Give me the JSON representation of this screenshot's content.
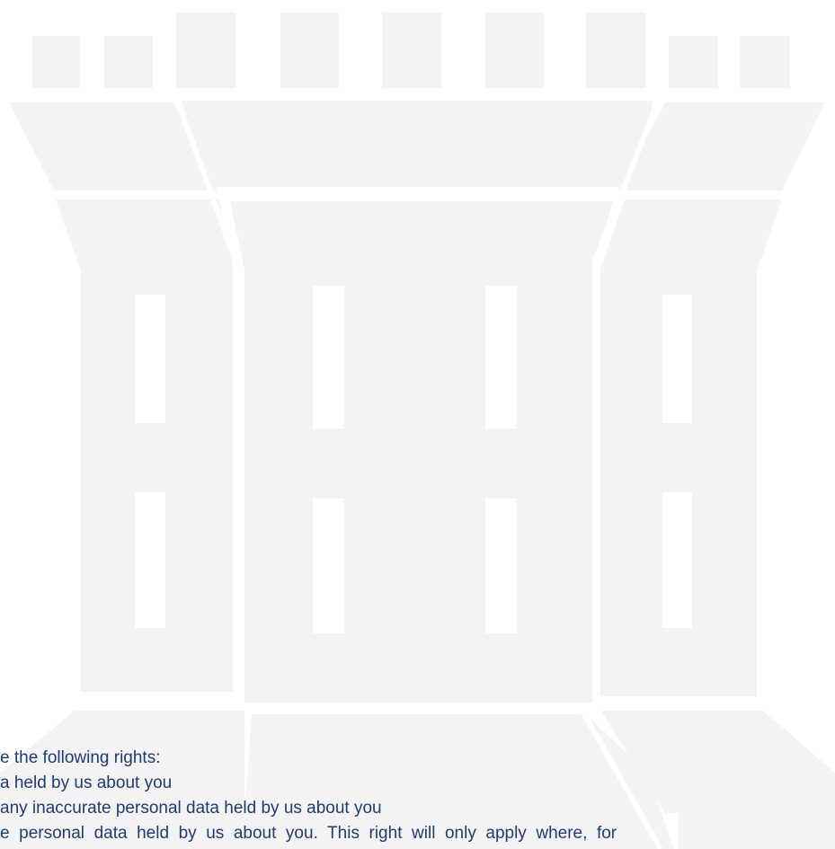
{
  "document": {
    "lines": [
      "e the following rights:",
      "a held by us about you",
      "any inaccurate personal data held by us about you",
      "e  personal  data  held  by  us  about  you.  This  right  will  only  apply  where,  for"
    ]
  },
  "colors": {
    "text": "#1f3b75",
    "watermark": "#f3f3f3"
  }
}
